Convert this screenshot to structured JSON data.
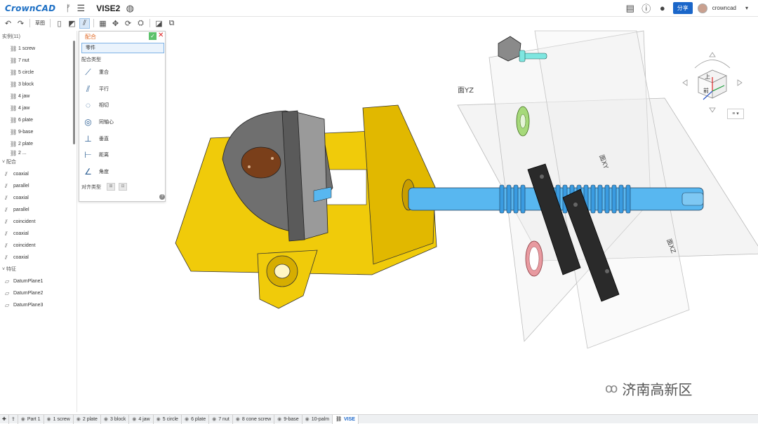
{
  "app": {
    "logo": "CrownCAD",
    "doc_title": "VISE2",
    "share_label": "分享",
    "username": "crowncad"
  },
  "toolbar": {
    "sketch_label": "草图"
  },
  "tree": {
    "instances_header": "实例(11)",
    "instances": [
      "1 screw",
      "7 nut",
      "5 circle",
      "3 block",
      "4 jaw",
      "4 jaw",
      "6 plate",
      "9-base",
      "2 plate",
      "2 ..."
    ],
    "mates_header": "配合",
    "mates": [
      "coaxial",
      "parallel",
      "coaxial",
      "parallel",
      "coincident",
      "coaxial",
      "coincident",
      "coaxial"
    ],
    "features_header": "特征",
    "features": [
      "DatumPlane1",
      "DatumPlane2",
      "DatumPlane3"
    ]
  },
  "mate_panel": {
    "title": "配合",
    "part_field": "零件",
    "mate_type_label": "配合类型",
    "options": [
      "重合",
      "平行",
      "相切",
      "同轴心",
      "垂直",
      "距离",
      "角度"
    ],
    "align_label": "对齐类型",
    "help": "?"
  },
  "viewport": {
    "plane_yz_label": "面YZ",
    "plane_xy_label": "面XY",
    "plane_xz_label": "面XZ",
    "view_cube_front": "前",
    "view_cube_top": "上",
    "view_dropdown": "≡"
  },
  "watermark": "济南高新区",
  "tabs": [
    "Part 1",
    "1 screw",
    "2 plate",
    "3 block",
    "4 jaw",
    "5 circle",
    "6 plate",
    "7 nut",
    "8 cone screw",
    "9-base",
    "10-palm",
    "VISE"
  ],
  "colors": {
    "accent": "#1a66c9",
    "panel_title": "#e06a26",
    "base_yellow": "#f0cb0a",
    "screw_blue": "#58b7f0",
    "jaw_gray": "#6f6f6f"
  }
}
